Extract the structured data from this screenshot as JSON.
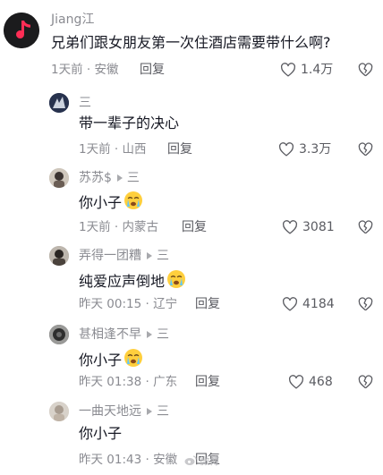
{
  "comments": [
    {
      "author": "Jiang江",
      "text": "兄弟们跟女朋友第一次住酒店需要带什么啊?",
      "meta": "1天前 · 安徽",
      "reply_label": "回复",
      "likes": "1.4万"
    },
    {
      "author": "三",
      "text": "带一辈子的决心",
      "meta": "1天前 · 山西",
      "reply_label": "回复",
      "likes": "3.3万"
    },
    {
      "author": "苏苏$",
      "reply_to": "三",
      "text": "你小子",
      "meta": "1天前 · 内蒙古",
      "reply_label": "回复",
      "likes": "3081"
    },
    {
      "author": "弄得一团糟",
      "reply_to": "三",
      "text": "纯爱应声倒地",
      "meta": "昨天 00:15 · 辽宁",
      "reply_label": "回复",
      "likes": "4184"
    },
    {
      "author": "甚相逢不早",
      "reply_to": "三",
      "text": "你小子",
      "meta": "昨天 01:38 · 广东",
      "reply_label": "回复",
      "likes": "468"
    },
    {
      "author": "一曲天地远",
      "reply_to": "三",
      "text": "你小子",
      "meta": "昨天 01:43 · 安徽",
      "reply_label": "回复"
    }
  ],
  "watermark": "微博",
  "icons": {
    "like": "heart-outline-icon",
    "dislike": "broken-heart-icon",
    "crying_emoji": "crying-face-emoji",
    "reply_arrow": "play-triangle-icon"
  },
  "colors": {
    "text": "#161823",
    "meta": "#8a8b91",
    "icon": "#5a5b61"
  }
}
